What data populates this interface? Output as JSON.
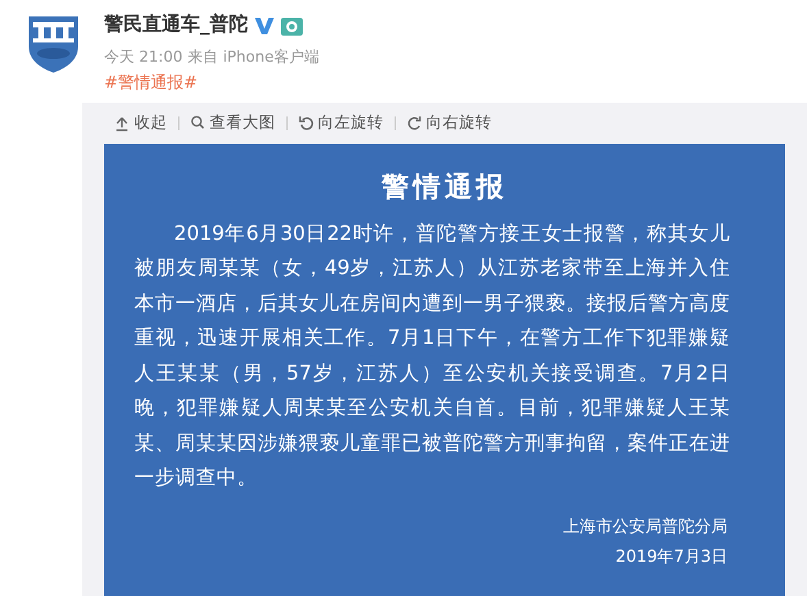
{
  "post": {
    "author": "警民直通车_普陀",
    "verified": true,
    "time": "今天 21:00",
    "source": "来自 iPhone客户端",
    "hashtag": "#警情通报#"
  },
  "toolbar": [
    {
      "kind": "collapse",
      "label": "收起"
    },
    {
      "kind": "zoom",
      "label": "查看大图"
    },
    {
      "kind": "rotate-left",
      "label": "向左旋转"
    },
    {
      "kind": "rotate-right",
      "label": "向右旋转"
    }
  ],
  "notice": {
    "title": "警情通报",
    "body": "2019年6月30日22时许，普陀警方接王女士报警，称其女儿被朋友周某某（女，49岁，江苏人）从江苏老家带至上海并入住本市一酒店，后其女儿在房间内遭到一男子猥亵。接报后警方高度重视，迅速开展相关工作。7月1日下午，在警方工作下犯罪嫌疑人王某某（男，57岁，江苏人）至公安机关接受调查。7月2日晚，犯罪嫌疑人周某某至公安机关自首。目前，犯罪嫌疑人王某某、周某某因涉嫌猥亵儿童罪已被普陀警方刑事拘留，案件正在进一步调查中。",
    "issuer": "上海市公安局普陀分局",
    "date": "2019年7月3日"
  }
}
